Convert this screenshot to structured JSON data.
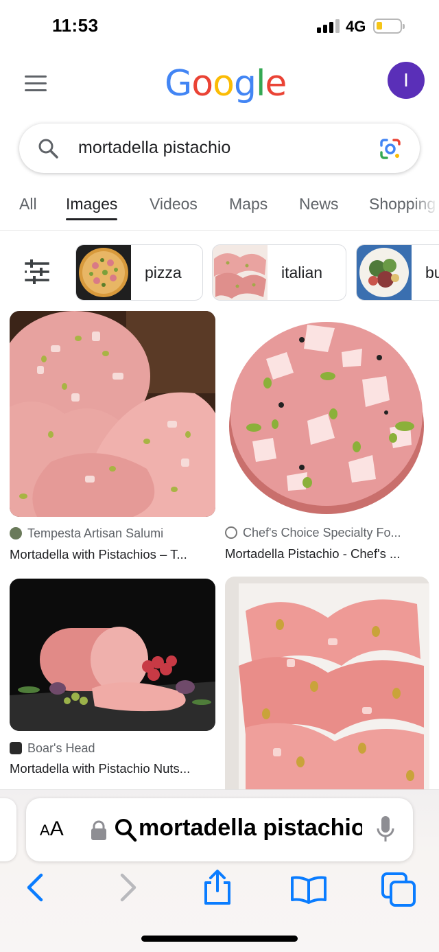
{
  "status_bar": {
    "time": "11:53",
    "network": "4G",
    "battery_color": "#f5c518"
  },
  "header": {
    "logo": "Google",
    "avatar_letter": "I",
    "avatar_color": "#5a2fb8"
  },
  "search": {
    "query": "mortadella pistachio",
    "search_icon": "search-icon",
    "lens_icon": "google-lens-icon"
  },
  "tabs": [
    {
      "label": "All",
      "active": false
    },
    {
      "label": "Images",
      "active": true
    },
    {
      "label": "Videos",
      "active": false
    },
    {
      "label": "Maps",
      "active": false
    },
    {
      "label": "News",
      "active": false
    },
    {
      "label": "Shopping",
      "active": false
    }
  ],
  "chips": [
    {
      "label": "pizza",
      "thumb": "pizza-thumbnail"
    },
    {
      "label": "italian",
      "thumb": "italian-mortadella-thumbnail"
    },
    {
      "label": "bu",
      "thumb": "salad-thumbnail"
    }
  ],
  "results": [
    {
      "source": "Tempesta Artisan Salumi",
      "title": "Mortadella with Pistachios – T..."
    },
    {
      "source": "Chef's Choice Specialty Fo...",
      "title": "Mortadella Pistachio - Chef's ..."
    },
    {
      "source": "Boar's Head",
      "title": "Mortadella with Pistachio Nuts..."
    },
    {
      "source": "",
      "title": ""
    }
  ],
  "safari": {
    "text_size_label": "AA",
    "address_text": "mortadella pistachio",
    "accent_color": "#0a7cff",
    "toolbar": [
      "back-icon",
      "forward-icon",
      "share-icon",
      "bookmarks-icon",
      "tabs-icon"
    ]
  }
}
